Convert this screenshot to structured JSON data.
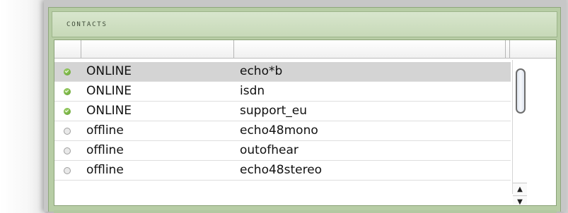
{
  "panel": {
    "title": "CONTACTS"
  },
  "contacts": [
    {
      "status": "ONLINE",
      "name": "echo*b",
      "online": true,
      "selected": true
    },
    {
      "status": "ONLINE",
      "name": "isdn",
      "online": true,
      "selected": false
    },
    {
      "status": "ONLINE",
      "name": "support_eu",
      "online": true,
      "selected": false
    },
    {
      "status": "offline",
      "name": "echo48mono",
      "online": false,
      "selected": false
    },
    {
      "status": "offline",
      "name": "outofhear",
      "online": false,
      "selected": false
    },
    {
      "status": "offline",
      "name": "echo48stereo",
      "online": false,
      "selected": false
    }
  ],
  "icons": {
    "online": "green-check-dot-icon",
    "offline": "gray-hollow-dot-icon",
    "scroll_up": "arrow-up-icon",
    "scroll_down": "arrow-down-icon"
  },
  "scrollbar": {
    "up_glyph": "▲",
    "down_glyph": "▼"
  },
  "colors": {
    "frame_green": "#b7cda5",
    "online_green": "#5f9b2c",
    "selected_row": "#d4d4d4"
  }
}
